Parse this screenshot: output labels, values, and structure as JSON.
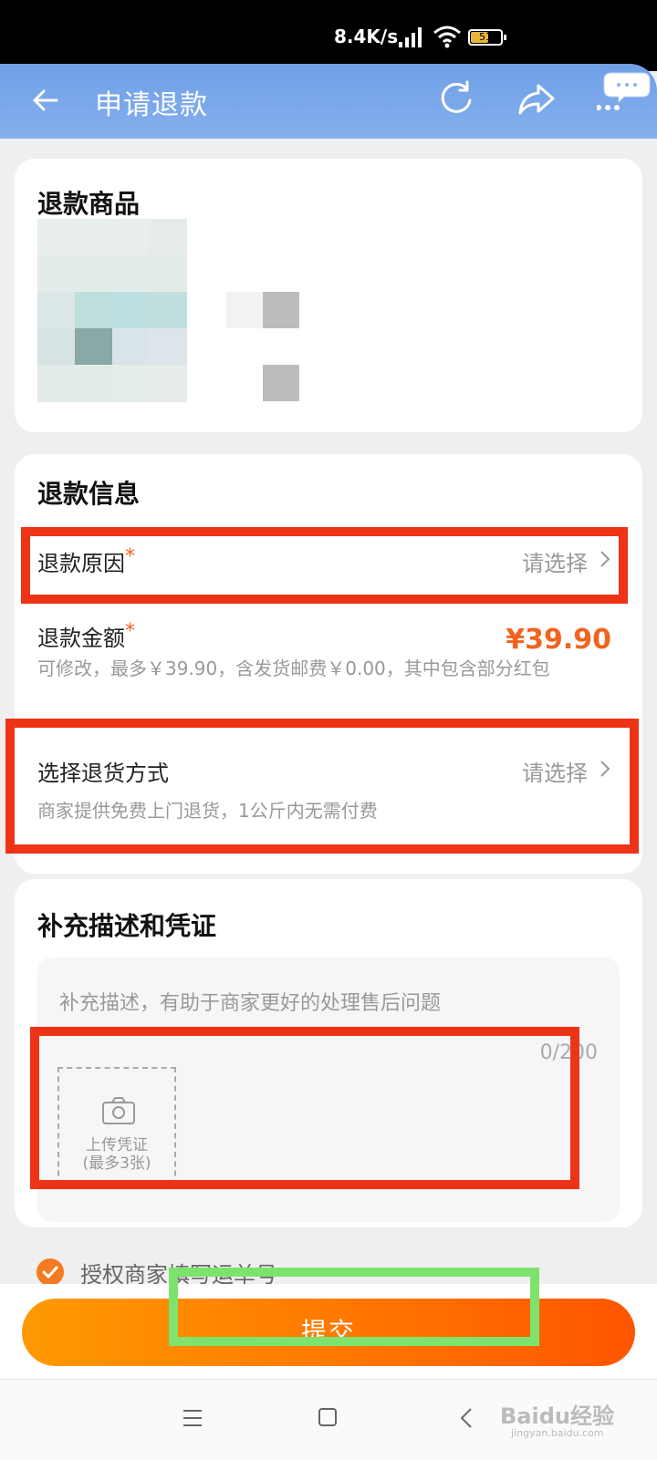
{
  "status_bar": {
    "network_speed": "8.4K/s",
    "battery_level": "51",
    "icons": [
      "signal-icon",
      "wifi-icon",
      "battery-icon"
    ]
  },
  "nav": {
    "title": "申请退款",
    "icons": [
      "back-arrow-icon",
      "refresh-icon",
      "share-icon",
      "more-icon"
    ]
  },
  "product_card": {
    "title": "退款商品"
  },
  "refund_info": {
    "title": "退款信息",
    "reason_label": "退款原因",
    "reason_required": "*",
    "reason_value": "请选择",
    "amount_label": "退款金额",
    "amount_required": "*",
    "amount_value": "¥39.90",
    "amount_hint": "可修改，最多￥39.90，含发货邮费￥0.00，其中包含部分红包",
    "return_method_label": "选择退货方式",
    "return_method_value": "请选择",
    "return_method_hint": "商家提供免费上门退货，1公斤内无需付费"
  },
  "description": {
    "title": "补充描述和凭证",
    "placeholder": "补充描述，有助于商家更好的处理售后问题",
    "counter": "0/200",
    "upload_label_1": "上传凭证",
    "upload_label_2": "(最多3张)"
  },
  "authorize": {
    "label": "授权商家填写运单号",
    "checked": true
  },
  "submit": {
    "label": "提交"
  },
  "system_nav": {
    "icons": [
      "menu-icon",
      "home-icon",
      "back-icon"
    ]
  },
  "watermark": {
    "text": "Baidu经验",
    "sub": "jingyan.baidu.com"
  },
  "colors": {
    "accent": "#f0641f",
    "nav_bg": "#6f9fe6",
    "highlight_red": "#ee3317",
    "highlight_green": "#7ee36d"
  }
}
